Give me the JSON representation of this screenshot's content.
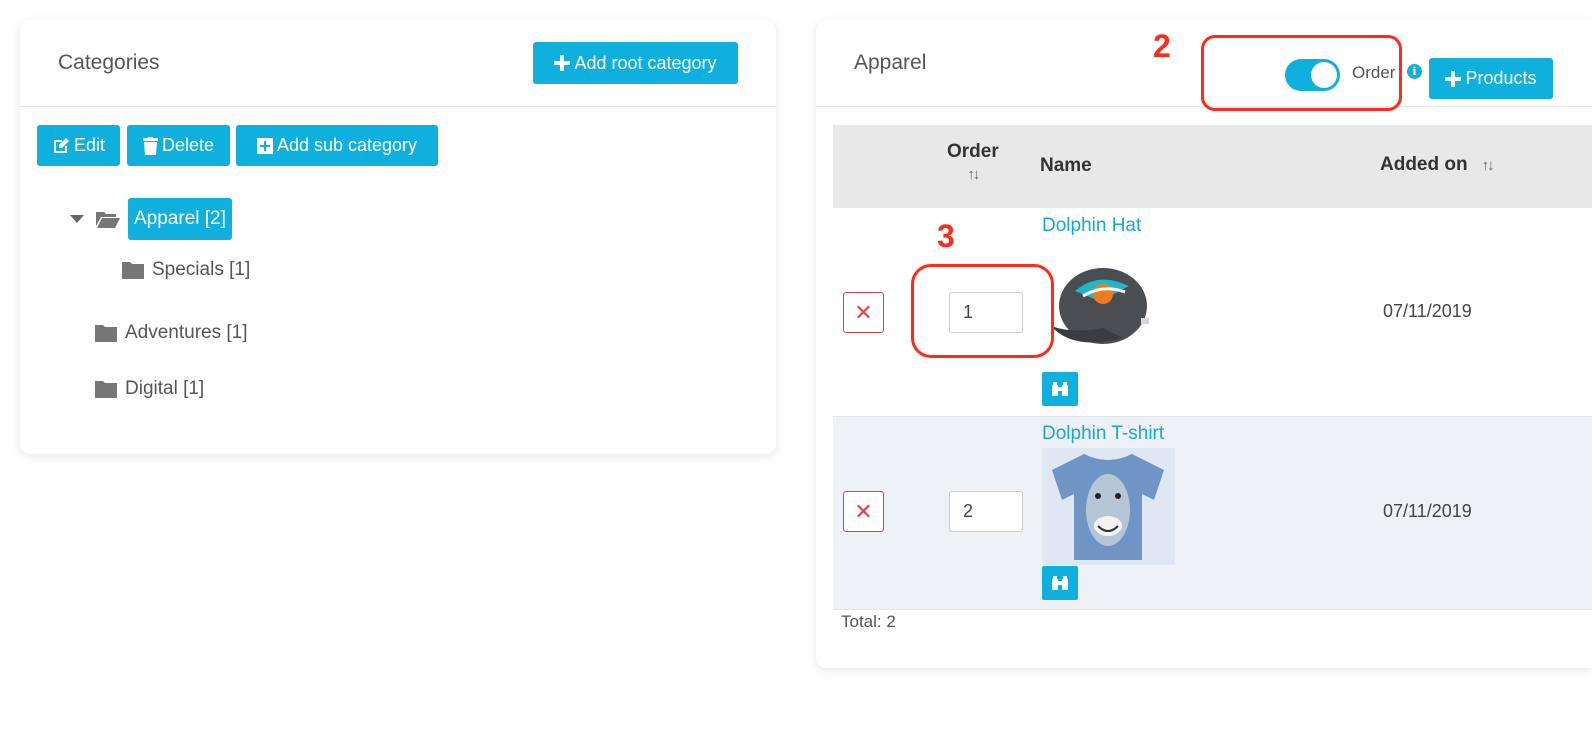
{
  "left_panel": {
    "title": "Categories",
    "add_root_label": "Add root category",
    "edit_label": "Edit",
    "delete_label": "Delete",
    "add_sub_label": "Add sub category",
    "tree": [
      {
        "label": "Apparel [2]",
        "selected": true,
        "expanded": true,
        "icon": "folder-open-icon"
      },
      {
        "label": "Specials [1]",
        "selected": false,
        "icon": "folder-icon"
      },
      {
        "label": "Adventures [1]",
        "selected": false,
        "icon": "folder-icon"
      },
      {
        "label": "Digital [1]",
        "selected": false,
        "icon": "folder-icon"
      }
    ]
  },
  "right_panel": {
    "title": "Apparel",
    "order_toggle_label": "Order",
    "order_toggle_on": true,
    "products_label": "Products",
    "columns": {
      "order": "Order",
      "name": "Name",
      "added_on": "Added on"
    },
    "rows": [
      {
        "order": "1",
        "name": "Dolphin Hat",
        "added_on": "07/11/2019",
        "image": "gray cap with dolphin logo"
      },
      {
        "order": "2",
        "name": "Dolphin T-shirt",
        "added_on": "07/11/2019",
        "image": "blue dolphin t-shirt"
      }
    ],
    "total": "Total: 2"
  },
  "annotations": {
    "marker_2": "2",
    "marker_3": "3"
  },
  "colors": {
    "accent": "#0fb0de",
    "annotation": "#ff2a1a",
    "delete": "#e0424a",
    "link": "#17a7d6"
  }
}
